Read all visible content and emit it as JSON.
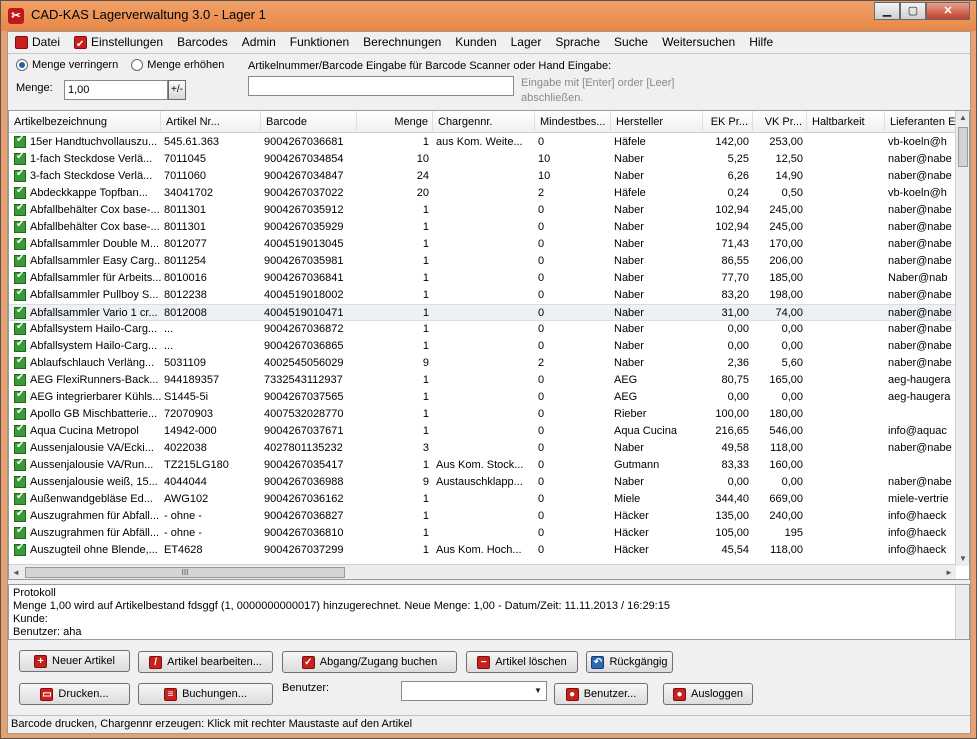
{
  "window": {
    "title": "CAD-KAS Lagerverwaltung 3.0 - Lager 1",
    "min_label": "▁",
    "max_label": "▢",
    "close_label": "✕"
  },
  "menu": [
    "Datei",
    "Einstellungen",
    "Barcodes",
    "Admin",
    "Funktionen",
    "Berechnungen",
    "Kunden",
    "Lager",
    "Sprache",
    "Suche",
    "Weitersuchen",
    "Hilfe"
  ],
  "options": {
    "verringern": "Menge verringern",
    "erhoehen": "Menge erhöhen",
    "menge_label": "Menge:",
    "menge_value": "1,00",
    "scan_label": "Artikelnummer/Barcode Eingabe für Barcode Scanner oder Hand Eingabe:",
    "scan_hint": "Eingabe mit [Enter] order [Leer] abschließen."
  },
  "table": {
    "headers": [
      "Artikelbezeichnung",
      "Artikel Nr...",
      "Barcode",
      "Menge",
      "Chargennr.",
      "Mindestbes...",
      "Hersteller",
      "EK Pr...",
      "VK Pr...",
      "Haltbarkeit",
      "Lieferanten E"
    ],
    "rows": [
      [
        "15er Handtuchvollauszu...",
        "545.61.363",
        "9004267036681",
        "1",
        "aus Kom. Weite...",
        "0",
        "Häfele",
        "142,00",
        "253,00",
        "",
        "vb-koeln@h"
      ],
      [
        "1-fach Steckdose Verlä...",
        "7011045",
        "9004267034854",
        "10",
        "",
        "10",
        "Naber",
        "5,25",
        "12,50",
        "",
        "naber@nabe"
      ],
      [
        "3-fach Steckdose Verlä...",
        "7011060",
        "9004267034847",
        "24",
        "",
        "10",
        "Naber",
        "6,26",
        "14,90",
        "",
        "naber@nabe"
      ],
      [
        "Abdeckkappe Topfban...",
        "34041702",
        "9004267037022",
        "20",
        "",
        "2",
        "Häfele",
        "0,24",
        "0,50",
        "",
        "vb-koeln@h"
      ],
      [
        "Abfallbehälter Cox base-...",
        "8011301",
        "9004267035912",
        "1",
        "",
        "0",
        "Naber",
        "102,94",
        "245,00",
        "",
        "naber@nabe"
      ],
      [
        "Abfallbehälter Cox base-...",
        "8011301",
        "9004267035929",
        "1",
        "",
        "0",
        "Naber",
        "102,94",
        "245,00",
        "",
        "naber@nabe"
      ],
      [
        "Abfallsammler Double M...",
        "8012077",
        "4004519013045",
        "1",
        "",
        "0",
        "Naber",
        "71,43",
        "170,00",
        "",
        "naber@nabe"
      ],
      [
        "Abfallsammler Easy Carg...",
        "8011254",
        "9004267035981",
        "1",
        "",
        "0",
        "Naber",
        "86,55",
        "206,00",
        "",
        "naber@nabe"
      ],
      [
        "Abfallsammler für Arbeits...",
        "8010016",
        "9004267036841",
        "1",
        "",
        "0",
        "Naber",
        "77,70",
        "185,00",
        "",
        "Naber@nab"
      ],
      [
        "Abfallsammler Pullboy S...",
        "8012238",
        "4004519018002",
        "1",
        "",
        "0",
        "Naber",
        "83,20",
        "198,00",
        "",
        "naber@nabe"
      ],
      [
        "Abfallsammler Vario 1 cr...",
        "8012008",
        "4004519010471",
        "1",
        "",
        "0",
        "Naber",
        "31,00",
        "74,00",
        "",
        "naber@nabe"
      ],
      [
        "Abfallsystem Hailo-Carg...",
        "...",
        "9004267036872",
        "1",
        "",
        "0",
        "Naber",
        "0,00",
        "0,00",
        "",
        "naber@nabe"
      ],
      [
        "Abfallsystem Hailo-Carg...",
        "...",
        "9004267036865",
        "1",
        "",
        "0",
        "Naber",
        "0,00",
        "0,00",
        "",
        "naber@nabe"
      ],
      [
        "Ablaufschlauch Verläng...",
        "5031109",
        "4002545056029",
        "9",
        "",
        "2",
        "Naber",
        "2,36",
        "5,60",
        "",
        "naber@nabe"
      ],
      [
        "AEG FlexiRunners-Back...",
        "944189357",
        "7332543112937",
        "1",
        "",
        "0",
        "AEG",
        "80,75",
        "165,00",
        "",
        "aeg-haugera"
      ],
      [
        "AEG integrierbarer Kühls...",
        "S1445-5i",
        "9004267037565",
        "1",
        "",
        "0",
        "AEG",
        "0,00",
        "0,00",
        "",
        "aeg-haugera"
      ],
      [
        "Apollo GB Mischbatterie...",
        "72070903",
        "4007532028770",
        "1",
        "",
        "0",
        "Rieber",
        "100,00",
        "180,00",
        "",
        ""
      ],
      [
        "Aqua Cucina Metropol",
        "14942-000",
        "9004267037671",
        "1",
        "",
        "0",
        "Aqua Cucina",
        "216,65",
        "546,00",
        "",
        "info@aquac"
      ],
      [
        "Aussenjalousie VA/Ecki...",
        "4022038",
        "4027801135232",
        "3",
        "",
        "0",
        "Naber",
        "49,58",
        "118,00",
        "",
        "naber@nabe"
      ],
      [
        "Aussenjalousie VA/Run...",
        "TZ215LG180",
        "9004267035417",
        "1",
        "Aus Kom. Stock...",
        "0",
        "Gutmann",
        "83,33",
        "160,00",
        "",
        ""
      ],
      [
        "Aussenjalousie weiß, 15...",
        "4044044",
        "9004267036988",
        "9",
        "Austauschklapp...",
        "0",
        "Naber",
        "0,00",
        "0,00",
        "",
        "naber@nabe"
      ],
      [
        "Außenwandgebläse Ed...",
        "AWG102",
        "9004267036162",
        "1",
        "",
        "0",
        "Miele",
        "344,40",
        "669,00",
        "",
        "miele-vertrie"
      ],
      [
        "Auszugrahmen für Abfall...",
        "- ohne -",
        "9004267036827",
        "1",
        "",
        "0",
        "Häcker",
        "135,00",
        "240,00",
        "",
        "info@haeck"
      ],
      [
        "Auszugrahmen für Abfäll...",
        "- ohne -",
        "9004267036810",
        "1",
        "",
        "0",
        "Häcker",
        "105,00",
        "195",
        "",
        "info@haeck"
      ],
      [
        "Auszugteil ohne Blende,...",
        "ET4628",
        "9004267037299",
        "1",
        "Aus Kom. Hoch...",
        "0",
        "Häcker",
        "45,54",
        "118,00",
        "",
        "info@haeck"
      ]
    ]
  },
  "protokoll": {
    "title": "Protokoll",
    "line1": "Menge 1,00 wird auf Artikelbestand fdsggf (1, 0000000000017) hinzugerechnet. Neue Menge: 1,00 - Datum/Zeit: 11.11.2013 / 16:29:15",
    "line2": "Kunde:",
    "line3": "Benutzer: aha"
  },
  "buttons": {
    "neu": "Neuer Artikel",
    "bearbeiten": "Artikel bearbeiten...",
    "abgang": "Abgang/Zugang buchen",
    "loeschen": "Artikel löschen",
    "rueck": "Rückgängig",
    "drucken": "Drucken...",
    "buchungen": "Buchungen...",
    "benutzer_label": "Benutzer:",
    "benutzer_btn": "Benutzer...",
    "ausloggen": "Ausloggen"
  },
  "status": "Barcode drucken, Chargennr erzeugen: Klick mit rechter Maustaste auf den Artikel",
  "scroll_glyphs": {
    "up": "▲",
    "down": "▼",
    "left": "◄",
    "right": "►",
    "grip": "III"
  }
}
